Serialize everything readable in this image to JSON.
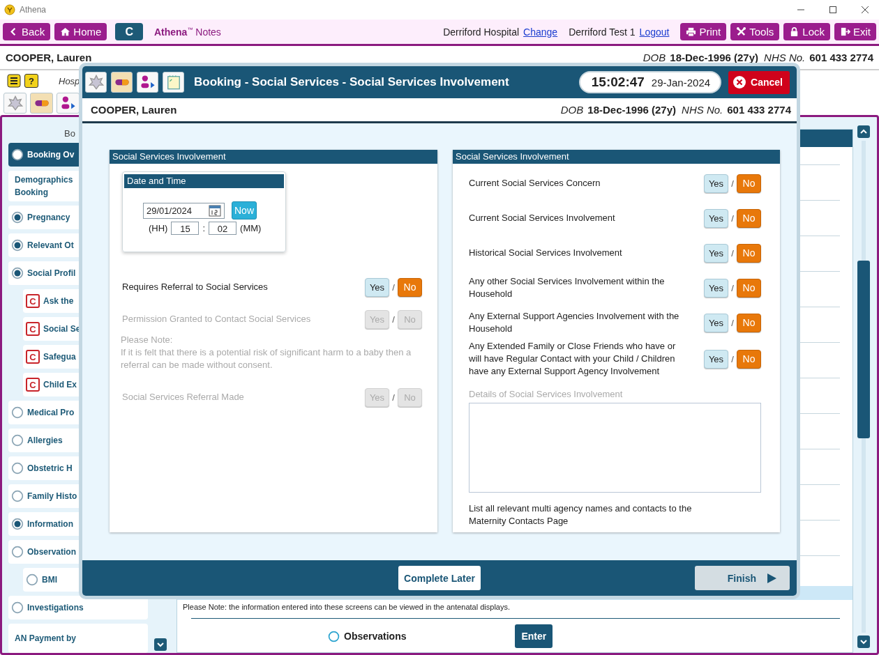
{
  "window": {
    "title": "Athena"
  },
  "toolbar": {
    "left_buttons": [
      {
        "kind": "back",
        "label": "Back"
      },
      {
        "kind": "home",
        "label": "Home"
      },
      {
        "kind": "plain",
        "label": "C"
      }
    ],
    "brand": "**Athena**$^{™}$ Notes",
    "hospital": "Derriford Hospital",
    "change_link": "Change",
    "user": "Derriford Test 1",
    "logout_link": "Logout",
    "right_buttons": [
      {
        "kind": "print",
        "label": "Print"
      },
      {
        "kind": "tools",
        "label": "Tools"
      },
      {
        "kind": "lock",
        "label": "Lock"
      },
      {
        "kind": "exit",
        "label": "Exit"
      }
    ]
  },
  "patient": {
    "name": "COOPER, Lauren",
    "dob_label": "DOB",
    "dob": "18-Dec-1996 (27y)",
    "nhs_label": "NHS No.",
    "nhs": "601 433 2774"
  },
  "info_row": {
    "help_label": "?",
    "text": "Hosp"
  },
  "sidebar": {
    "heading": "Bo",
    "items": [
      {
        "kind": "radio",
        "label": "Booking Ov",
        "checked": false,
        "selected": true
      },
      {
        "kind": "plain",
        "label": "Demographics\nBooking",
        "selected": false
      },
      {
        "kind": "radio",
        "label": "Pregnancy",
        "checked": true,
        "selected": false
      },
      {
        "kind": "radio",
        "label": "Relevant Ot",
        "checked": true,
        "selected": false
      },
      {
        "kind": "radio",
        "label": "Social Profil",
        "checked": true,
        "selected": false,
        "children": [
          {
            "kind": "badge",
            "badge": "C",
            "label": "Ask the",
            "selected": false
          },
          {
            "kind": "badge",
            "badge": "C",
            "label": "Social Se",
            "selected": false
          },
          {
            "kind": "badge",
            "badge": "C",
            "label": "Safegua",
            "selected": false
          },
          {
            "kind": "badge",
            "badge": "C",
            "label": "Child Ex",
            "selected": false
          }
        ]
      },
      {
        "kind": "radio",
        "label": "Medical Pro",
        "checked": false,
        "selected": false
      },
      {
        "kind": "radio",
        "label": "Allergies",
        "checked": false,
        "selected": false
      },
      {
        "kind": "radio",
        "label": "Obstetric H",
        "checked": false,
        "selected": false
      },
      {
        "kind": "radio",
        "label": "Family Histo",
        "checked": false,
        "selected": false
      },
      {
        "kind": "radio",
        "label": "Information",
        "checked": true,
        "selected": false
      },
      {
        "kind": "radio",
        "label": "Observation",
        "checked": false,
        "selected": false,
        "children": [
          {
            "kind": "radio",
            "label": "BMI",
            "checked": false,
            "selected": false
          }
        ]
      },
      {
        "kind": "radio",
        "label": "Investigations",
        "checked": false,
        "selected": false
      },
      {
        "kind": "plain",
        "label": "AN Payment by",
        "selected": false
      }
    ]
  },
  "content": {
    "note": "Please Note: the information entered into these screens can be viewed in the antenatal displays.",
    "option": {
      "label": "Observations",
      "checked": false
    },
    "enter_button": "Enter"
  },
  "modal": {
    "title": "Booking - Social Services - Social Services Involvement",
    "time": "15:02:47",
    "date": "29-Jan-2024",
    "cancel": "Cancel",
    "patient": {
      "name": "COOPER, Lauren",
      "dob_label": "DOB",
      "dob": "18-Dec-1996 (27y)",
      "nhs_label": "NHS No.",
      "nhs": "601 433 2774"
    },
    "left_panel": {
      "title": "Social Services Involvement",
      "datetime": {
        "title": "Date and Time",
        "date": "29/01/2024",
        "now": "Now",
        "hh_label": "(HH)",
        "hh": "15",
        "separator": ":",
        "mm": "02",
        "mm_label": "(MM)"
      },
      "items": [
        {
          "kind": "question",
          "label": "Requires Referral to Social Services",
          "disabled": false,
          "separator": "/",
          "options": [
            {
              "label": "Yes",
              "selected": false
            },
            {
              "label": "No",
              "selected": true
            }
          ]
        },
        {
          "kind": "question",
          "label": "Permission Granted to Contact Social Services",
          "disabled": true,
          "separator": "/",
          "options": [
            {
              "label": "Yes",
              "selected": false
            },
            {
              "label": "No",
              "selected": false
            }
          ]
        },
        {
          "kind": "note",
          "disabled": true,
          "lines": [
            "Please Note:",
            "If it is felt that there is a potential risk of significant harm to a baby then a referral can be made without consent."
          ]
        },
        {
          "kind": "question",
          "label": "Social Services Referral Made",
          "disabled": true,
          "separator": "/",
          "options": [
            {
              "label": "Yes",
              "selected": false
            },
            {
              "label": "No",
              "selected": false
            }
          ]
        }
      ]
    },
    "right_panel": {
      "title": "Social Services Involvement",
      "items": [
        {
          "kind": "question",
          "label": "Current Social Services Concern",
          "disabled": false,
          "separator": "/",
          "options": [
            {
              "label": "Yes",
              "selected": false
            },
            {
              "label": "No",
              "selected": true
            }
          ]
        },
        {
          "kind": "question",
          "label": "Current Social Services Involvement",
          "disabled": false,
          "separator": "/",
          "options": [
            {
              "label": "Yes",
              "selected": false
            },
            {
              "label": "No",
              "selected": true
            }
          ]
        },
        {
          "kind": "question",
          "label": "Historical Social Services Involvement",
          "disabled": false,
          "separator": "/",
          "options": [
            {
              "label": "Yes",
              "selected": false
            },
            {
              "label": "No",
              "selected": true
            }
          ]
        },
        {
          "kind": "question",
          "label": "Any other Social Services Involvement within the Household",
          "disabled": false,
          "separator": "/",
          "options": [
            {
              "label": "Yes",
              "selected": false
            },
            {
              "label": "No",
              "selected": true
            }
          ]
        },
        {
          "kind": "question",
          "label": "Any External Support Agencies Involvement with the Household",
          "disabled": false,
          "separator": "/",
          "options": [
            {
              "label": "Yes",
              "selected": false
            },
            {
              "label": "No",
              "selected": true
            }
          ]
        },
        {
          "kind": "question",
          "label": "Any Extended Family or Close Friends who have or will have Regular Contact with your Child / Children have any External Support Agency Involvement",
          "disabled": false,
          "separator": "/",
          "options": [
            {
              "label": "Yes",
              "selected": false
            },
            {
              "label": "No",
              "selected": true
            }
          ]
        }
      ],
      "details": {
        "label": "Details of Social Services Involvement",
        "disabled": true
      },
      "footer": "List all relevant multi agency names and contacts to the Maternity Contacts Page"
    },
    "buttons": [
      {
        "kind": "complete",
        "label": "Complete Later",
        "disabled": false
      },
      {
        "kind": "finish",
        "label": "Finish",
        "disabled": true
      }
    ]
  }
}
